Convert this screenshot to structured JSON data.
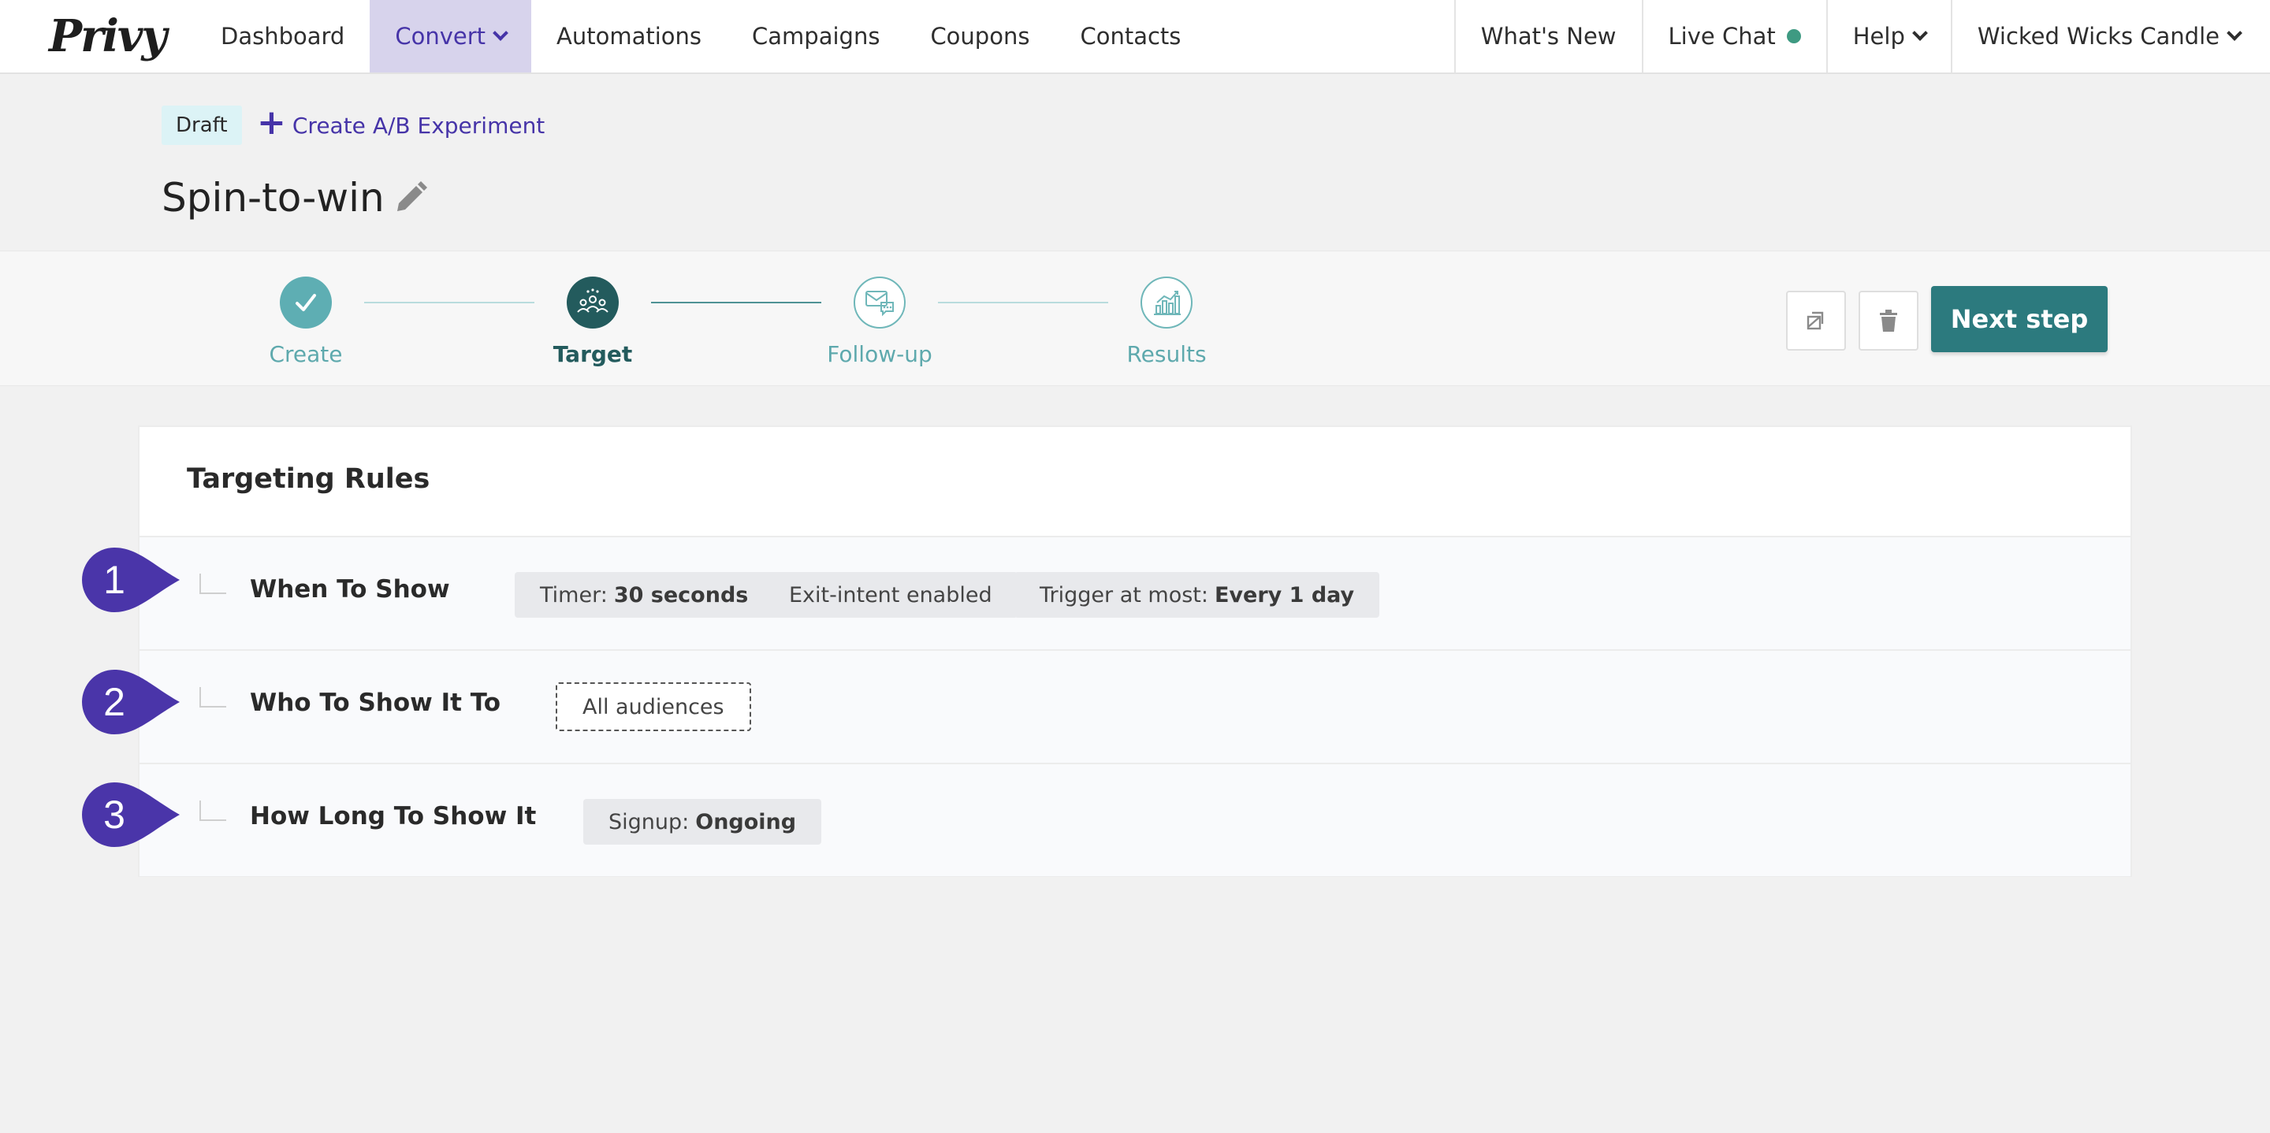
{
  "nav": {
    "logo": "Privy",
    "items": [
      {
        "label": "Dashboard"
      },
      {
        "label": "Convert"
      },
      {
        "label": "Automations"
      },
      {
        "label": "Campaigns"
      },
      {
        "label": "Coupons"
      },
      {
        "label": "Contacts"
      }
    ],
    "right": {
      "whats_new": "What's New",
      "live_chat": "Live Chat",
      "help": "Help",
      "account": "Wicked Wicks Candle"
    }
  },
  "header": {
    "status_badge": "Draft",
    "ab_link": "Create A/B Experiment",
    "title": "Spin-to-win"
  },
  "stepper": {
    "steps": [
      {
        "label": "Create",
        "state": "done"
      },
      {
        "label": "Target",
        "state": "current"
      },
      {
        "label": "Follow-up",
        "state": "todo"
      },
      {
        "label": "Results",
        "state": "todo"
      }
    ],
    "next_label": "Next step"
  },
  "targeting": {
    "title": "Targeting Rules",
    "rules": [
      {
        "marker": "1",
        "name": "When To Show",
        "pills": [
          {
            "prefix": "Timer:",
            "value": "30 seconds"
          },
          {
            "prefix": "Exit-intent enabled",
            "value": ""
          },
          {
            "prefix": "Trigger at most:",
            "value": "Every 1 day"
          }
        ]
      },
      {
        "marker": "2",
        "name": "Who To Show It To",
        "pills": [
          {
            "prefix": "All audiences",
            "value": ""
          }
        ]
      },
      {
        "marker": "3",
        "name": "How Long To Show It",
        "pills": [
          {
            "prefix": "Signup:",
            "value": "Ongoing"
          }
        ]
      }
    ]
  },
  "colors": {
    "brand_purple": "#4634a8",
    "teal_primary": "#2c7a7e",
    "teal_dark": "#235b5d",
    "teal_light": "#5eaeb3",
    "marker_purple": "#4a35a9",
    "live_dot": "#3e9a82"
  }
}
